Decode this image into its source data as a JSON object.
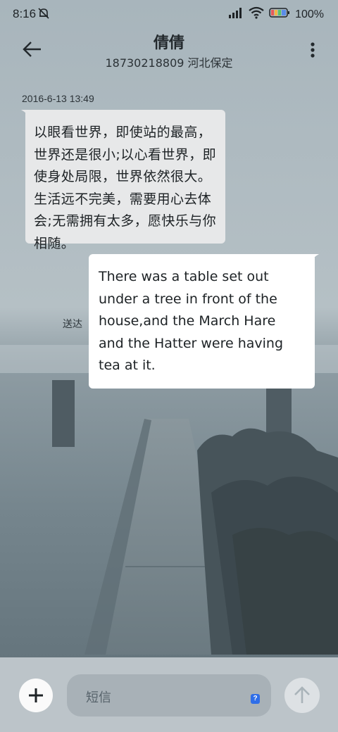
{
  "status_bar": {
    "time": "8:16",
    "battery_percent": "100%",
    "icons": [
      "bell-off-icon",
      "signal-icon",
      "wifi-icon",
      "battery-icon"
    ]
  },
  "header": {
    "contact_name": "倩倩",
    "contact_detail": "18730218809 河北保定",
    "icons": [
      "back-arrow-icon",
      "more-vertical-icon"
    ]
  },
  "conversation": {
    "timestamp": "2016-6-13 13:49",
    "received_message": "以眼看世界，即使站的最高，世界还是很小;以心看世界，即使身处局限，世界依然很大。生活远不完美，需要用心去体会;无需拥有太多，愿快乐与你相随。",
    "sent_message": "There was a table set out under a tree in front of the house,and the March Hare and the Hatter were having tea at it.",
    "sent_status": "送达"
  },
  "composer": {
    "placeholder": "短信",
    "sim_badge": "?",
    "icons": [
      "plus-icon",
      "send-arrow-up-icon"
    ]
  },
  "colors": {
    "background": "#aab6bd",
    "received_bubble": "#e7e8e9",
    "sent_bubble": "#ffffff",
    "composer_bar": "#bcc4c9",
    "sim_badge": "#2f6ee8"
  }
}
